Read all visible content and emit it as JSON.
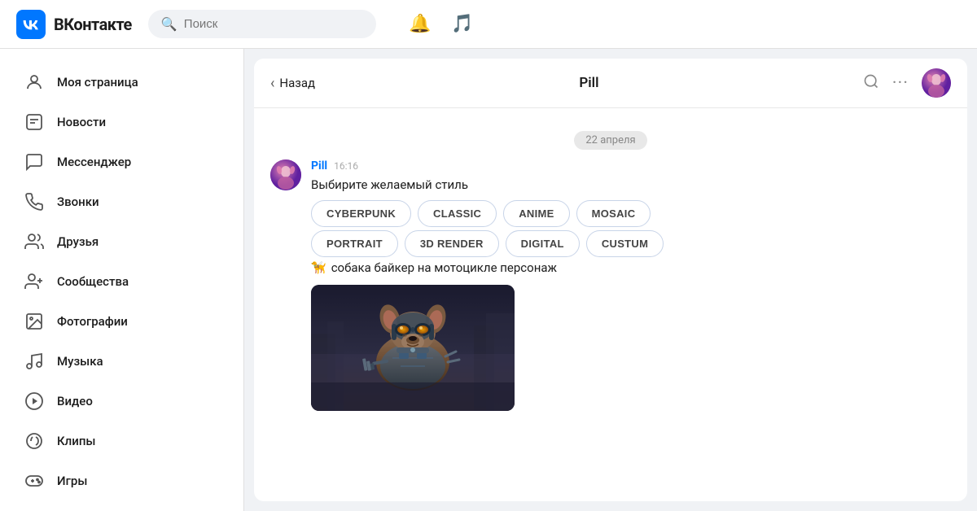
{
  "app": {
    "name": "ВКонтакте",
    "logo_letter": "ВК"
  },
  "topbar": {
    "search_placeholder": "Поиск"
  },
  "sidebar": {
    "items": [
      {
        "id": "my-page",
        "label": "Моя страница",
        "icon": "👤"
      },
      {
        "id": "news",
        "label": "Новости",
        "icon": "🗂"
      },
      {
        "id": "messenger",
        "label": "Мессенджер",
        "icon": "💬"
      },
      {
        "id": "calls",
        "label": "Звонки",
        "icon": "📞"
      },
      {
        "id": "friends",
        "label": "Друзья",
        "icon": "👥"
      },
      {
        "id": "communities",
        "label": "Сообщества",
        "icon": "👥"
      },
      {
        "id": "photos",
        "label": "Фотографии",
        "icon": "🖼"
      },
      {
        "id": "music",
        "label": "Музыка",
        "icon": "🎵"
      },
      {
        "id": "video",
        "label": "Видео",
        "icon": "▶"
      },
      {
        "id": "clips",
        "label": "Клипы",
        "icon": "🎬"
      },
      {
        "id": "games",
        "label": "Игры",
        "icon": "🎮"
      }
    ]
  },
  "chat": {
    "back_label": "Назад",
    "title": "Pill",
    "date_divider": "22 апреля",
    "message": {
      "sender": "Pill",
      "time": "16:16",
      "text": "Выбирите желаемый стиль",
      "style_buttons": [
        "CYBERPUNK",
        "CLASSIC",
        "ANIME",
        "MOSAIC",
        "PORTRAIT",
        "3D RENDER",
        "DIGITAL",
        "CUSTUM"
      ],
      "dog_message": "🦮 собака байкер на мотоцикле персонаж"
    }
  }
}
